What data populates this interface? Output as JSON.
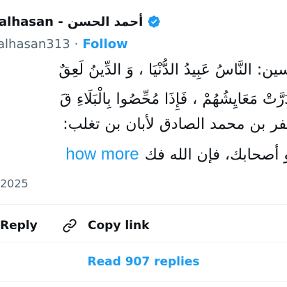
{
  "author": {
    "display_name": "alhasan - أحمد الحسن",
    "handle": "alhasan313",
    "separator": "·",
    "follow_label": "Follow",
    "verified": true
  },
  "tweet": {
    "lines": [
      "سين: النَّاسُ عَبِيدُ الدُّنْيَا ، وَ الدِّينُ لَعِقٌ",
      "دَرَّتْ مَعَايِشُهُمْ ، فَإِذَا مُحِّصُوا بِالْبَلَاءِ قَ",
      "ـفر بن محمد الصادق لأبان بن تغلب:",
      "و أصحابك، فإن الله فك"
    ],
    "show_more_label": "how more"
  },
  "timestamp": "2025",
  "actions": {
    "reply_label": "Reply",
    "copy_link_label": "Copy link"
  },
  "read_replies_label": "Read 907 replies",
  "colors": {
    "accent": "#1d9bf0",
    "text": "#0f1419",
    "muted": "#536471",
    "divider": "#eff3f4"
  },
  "icons": {
    "verified": "verified-badge-icon",
    "copy_link": "link-icon"
  }
}
